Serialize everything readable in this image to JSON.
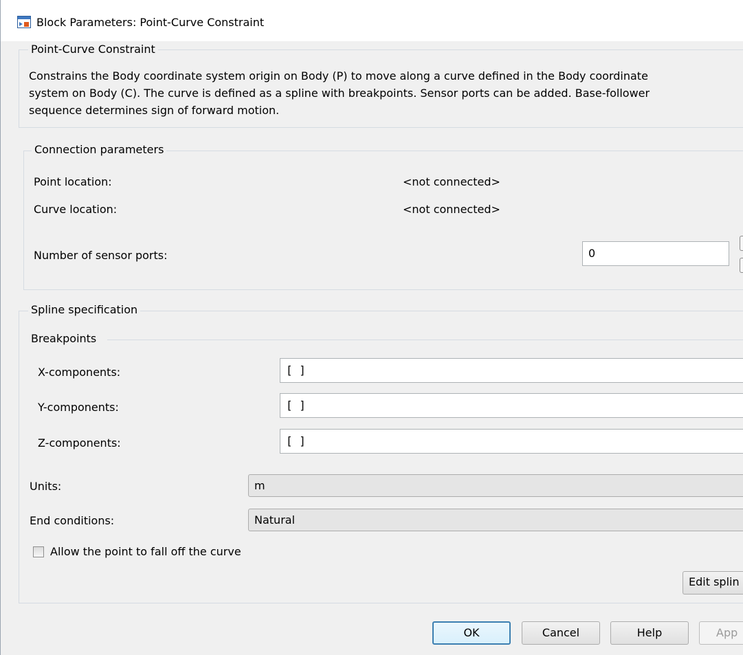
{
  "window": {
    "title": "Block Parameters: Point-Curve Constraint"
  },
  "block": {
    "legend": "Point-Curve Constraint",
    "description": [
      "Constrains the Body coordinate system origin on Body (P) to move along a curve defined in the Body coordinate",
      "system on Body (C). The curve is defined as a spline with breakpoints. Sensor ports can be added. Base-follower",
      "sequence determines sign of forward motion."
    ]
  },
  "connection": {
    "legend": "Connection parameters",
    "point_location_label": "Point location:",
    "point_location_value": "<not connected>",
    "curve_location_label": "Curve location:",
    "curve_location_value": "<not connected>",
    "sensor_ports_label": "Number of sensor ports:",
    "sensor_ports_value": "0"
  },
  "spline": {
    "legend": "Spline specification",
    "breakpoints_legend": "Breakpoints",
    "x_label": "X-components:",
    "x_value": "[ ]",
    "y_label": "Y-components:",
    "y_value": "[ ]",
    "z_label": "Z-components:",
    "z_value": "[ ]",
    "units_label": "Units:",
    "units_value": "m",
    "end_conditions_label": "End conditions:",
    "end_conditions_value": "Natural",
    "allow_falloff_label": "Allow the point to fall off the curve",
    "allow_falloff_checked": false,
    "edit_button": "Edit splin"
  },
  "buttons": {
    "ok": "OK",
    "cancel": "Cancel",
    "help": "Help",
    "apply": "App"
  },
  "colors": {
    "window_bg": "#f0f0f0",
    "group_border": "#d5dbe2",
    "default_button_border": "#3c7fb1"
  },
  "icons": {
    "title": "simulink-block-icon"
  }
}
